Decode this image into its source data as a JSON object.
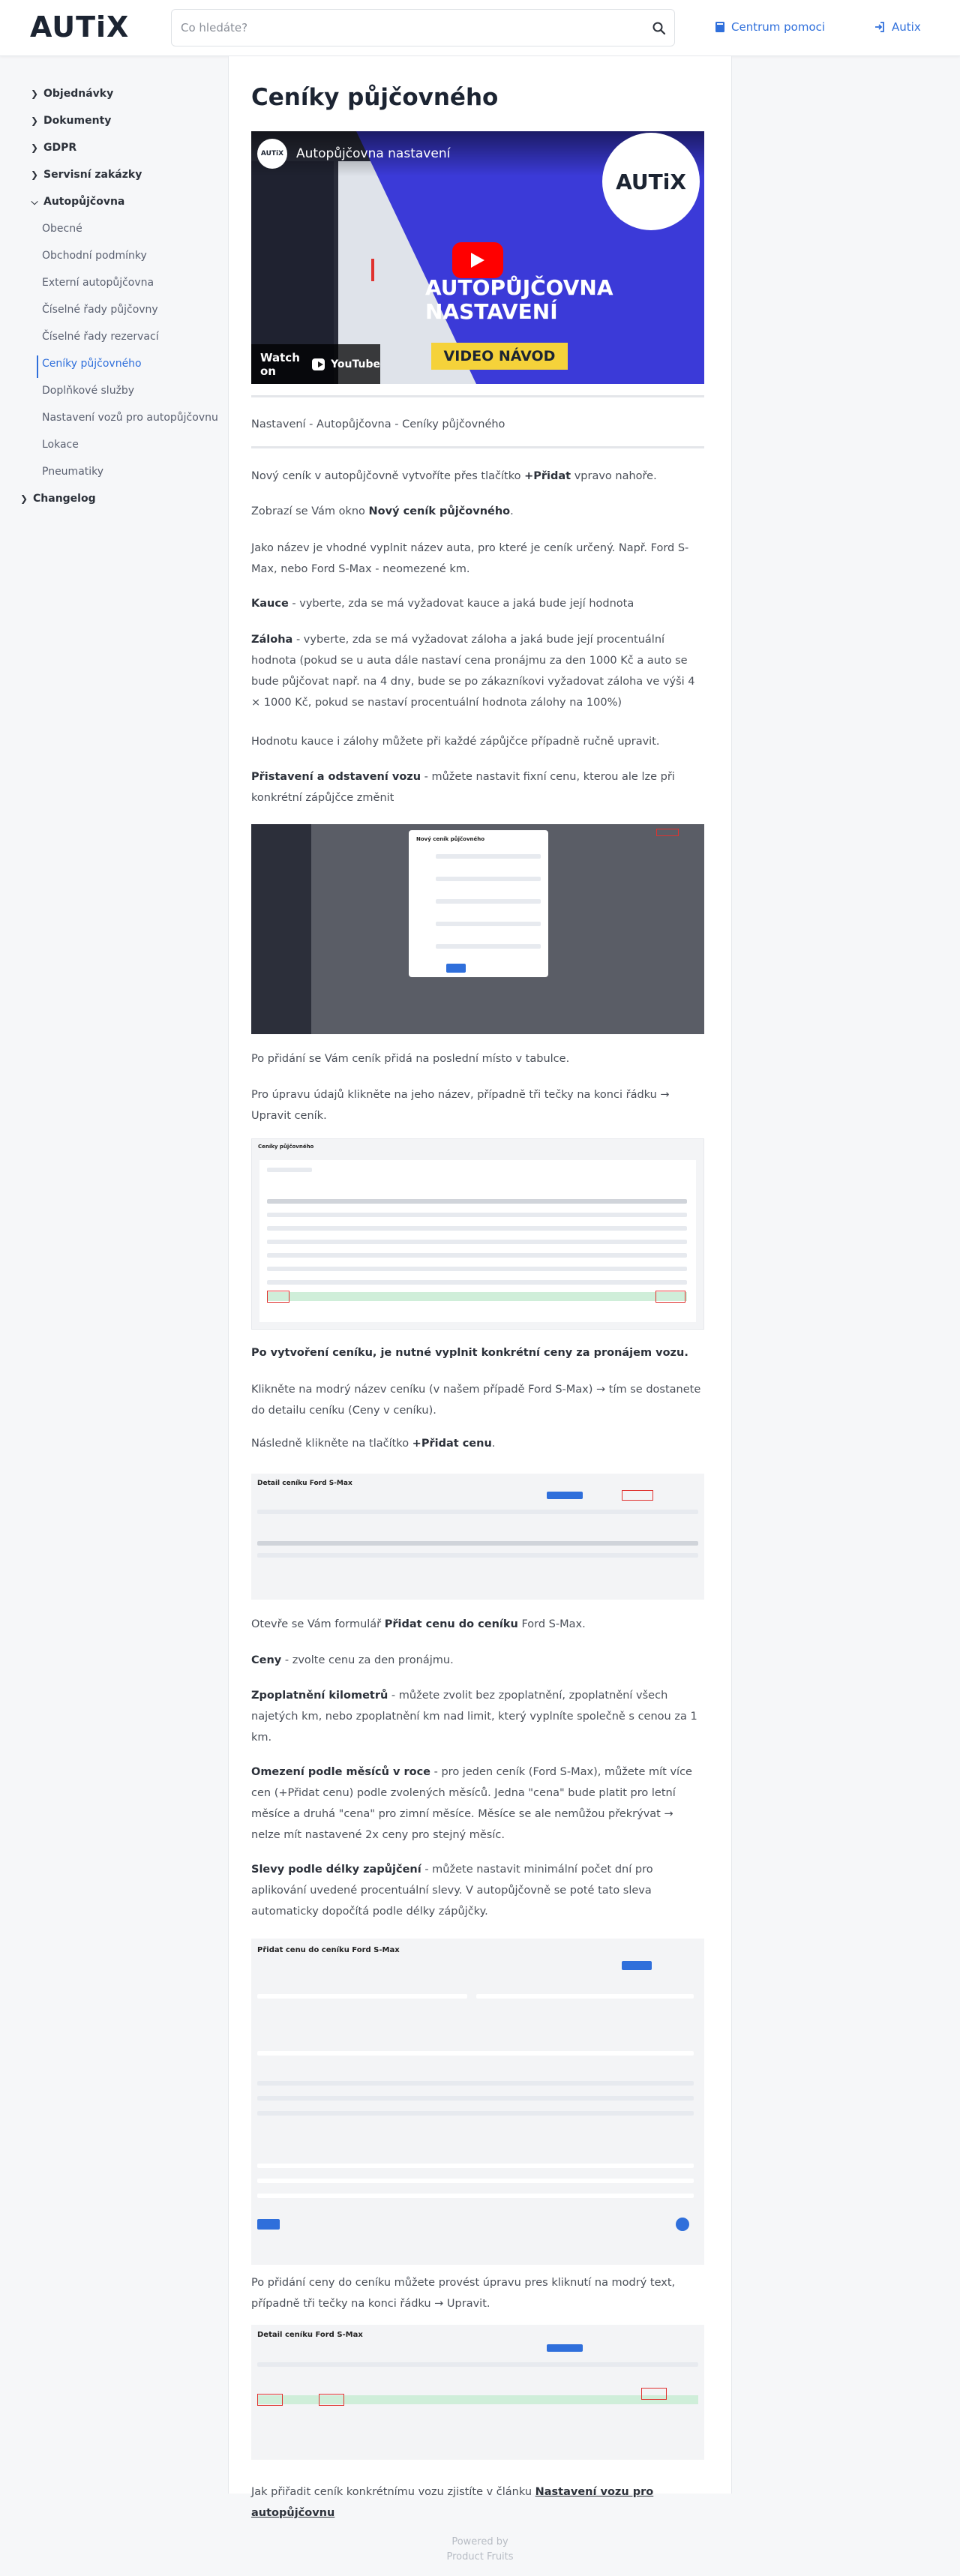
{
  "header": {
    "logo": "AUTiX",
    "search_placeholder": "Co hledáte?",
    "help_label": "Centrum pomoci",
    "login_label": "Autix"
  },
  "sidebar": {
    "items": [
      {
        "label": "Objednávky"
      },
      {
        "label": "Dokumenty"
      },
      {
        "label": "GDPR"
      },
      {
        "label": "Servisní zakázky"
      },
      {
        "label": "Autopůjčovna"
      },
      {
        "label": "Obecné"
      },
      {
        "label": "Obchodní podmínky"
      },
      {
        "label": "Externí autopůjčovna"
      },
      {
        "label": "Číselné řady půjčovny"
      },
      {
        "label": "Číselné řady rezervací"
      },
      {
        "label": "Ceníky půjčovného"
      },
      {
        "label": "Doplňkové služby"
      },
      {
        "label": "Nastavení vozů pro autopůjčovnu"
      },
      {
        "label": "Lokace"
      },
      {
        "label": "Pneumatiky"
      },
      {
        "label": "Changelog"
      }
    ]
  },
  "article": {
    "title": "Ceníky půjčovného",
    "video": {
      "title": "Autopůjčovna nastavení",
      "brand": "AUTiX",
      "heading_line1": "AUTOPŮJČOVNA",
      "heading_line2": "NASTAVENÍ",
      "badge": "VIDEO NÁVOD",
      "watch_on": "Watch on",
      "youtube": "YouTube"
    },
    "breadcrumb": "Nastavení - Autopůjčovna - Ceníky půjčovného",
    "p1a": "Nový ceník v autopůjčovně vytvoříte přes tlačítko ",
    "p1b": "+Přidat",
    "p1c": " vpravo nahoře.",
    "p2a": "Zobrazí se Vám okno ",
    "p2b": "Nový ceník půjčovného",
    "p2c": ".",
    "p3": "Jako název je vhodné vyplnit název auta, pro které je ceník určený. Např. Ford S-Max, nebo Ford S-Max - neomezené km.",
    "p4a": "Kauce",
    "p4b": " - vyberte, zda se má vyžadovat kauce a jaká bude její hodnota",
    "p5a": "Záloha",
    "p5b": " - vyberte, zda se má vyžadovat záloha a jaká bude její procentuální hodnota (pokud se u auta dále nastaví cena pronájmu za den 1000 Kč a auto se bude půjčovat např. na 4 dny, bude se po zákazníkovi vyžadovat záloha ve výši 4 × 1000 Kč, pokud se nastaví procentuální hodnota zálohy na 100%)",
    "p6": "Hodnotu kauce i zálohy můžete při každé zápůjčce případně ručně upravit.",
    "p7a": "Přistavení a odstavení vozu",
    "p7b": " - můžete nastavit fixní cenu, kterou ale lze při konkrétní zápůjčce změnit",
    "p8": "Po přidání se Vám ceník přidá na poslední místo v tabulce.",
    "p9": "Pro úpravu údajů klikněte na jeho název, případně tři tečky na konci řádku → Upravit ceník.",
    "p10": "Po vytvoření ceníku, je nutné vyplnit konkrétní ceny za pronájem vozu.",
    "p11": "Klikněte na modrý název ceníku (v našem případě Ford S-Max) → tím se dostanete do detailu ceníku (Ceny v ceníku).",
    "p12a": "Následně klikněte na tlačítko ",
    "p12b": "+Přidat cenu",
    "p12c": ".",
    "p13a": "Otevře se Vám formulář ",
    "p13b": "Přidat cenu do ceníku",
    "p13c": " Ford S-Max.",
    "p14a": "Ceny",
    "p14b": " - zvolte cenu za den pronájmu.",
    "p15a": "Zpoplatnění kilometrů",
    "p15b": " - můžete zvolit bez zpoplatnění, zpoplatnění všech najetých km, nebo zpoplatnění km nad limit, který vyplníte společně s cenou za 1 km.",
    "p16a": "Omezení podle měsíců v roce",
    "p16b": " - pro jeden ceník (Ford S-Max), můžete mít více cen (+Přidat cenu) podle zvolených měsíců. Jedna \"cena\" bude platit pro letní měsíce a druhá \"cena\" pro zimní měsíce. Měsíce se ale nemůžou překrývat → nelze mít nastavené 2x ceny pro stejný měsíc.",
    "p17a": "Slevy podle délky zapůjčení",
    "p17b": " - můžete nastavit minimální počet dní pro aplikování uvedené procentuální slevy. V autopůjčovně se poté tato sleva automaticky dopočítá podle délky zápůjčky.",
    "p18": "Po přidání ceny do ceníku můžete provést úpravu pres kliknutí na modrý text, případně tři tečky na konci řádku → Upravit.",
    "p19a": "Jak přiřadit ceník konkrétnímu vozu zjistíte v článku ",
    "p19b": "Nastavení vozu pro autopůjčovnu",
    "shot1_header": "Nový ceník půjčovného",
    "shot2_header": "Ceníky půjčovného",
    "shot3_header": "Detail ceníku Ford S-Max",
    "shot4_header": "Přidat cenu do ceníku Ford S-Max",
    "shot5_header": "Detail ceníku Ford S-Max"
  },
  "footer": {
    "line1": "Powered by",
    "line2": "Product Fruits"
  },
  "colors": {
    "accent": "#2f6fdb",
    "video_bg": "#3b3ad8",
    "badge_bg": "#f5d23a",
    "youtube_red": "#ff0000"
  }
}
